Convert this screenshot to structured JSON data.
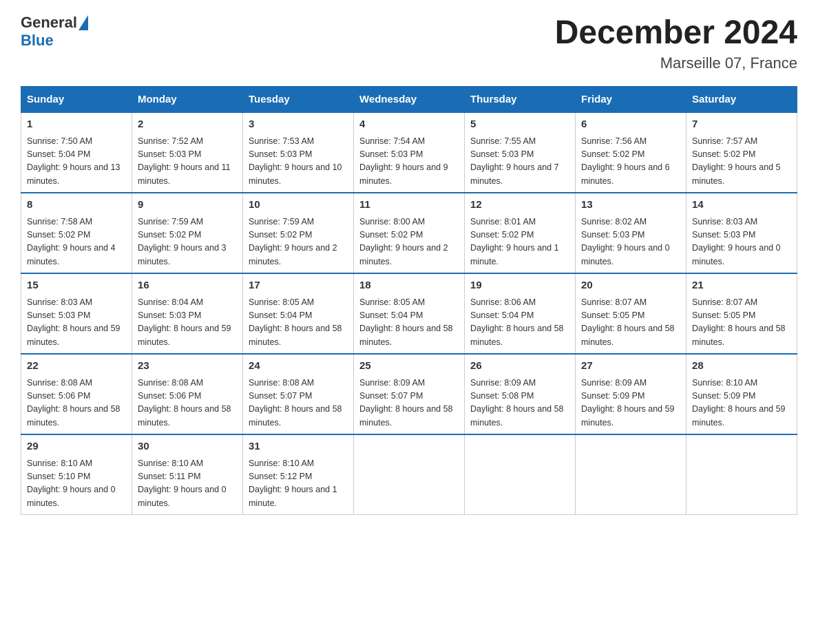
{
  "logo": {
    "general": "General",
    "blue": "Blue"
  },
  "header": {
    "month": "December 2024",
    "location": "Marseille 07, France"
  },
  "days_of_week": [
    "Sunday",
    "Monday",
    "Tuesday",
    "Wednesday",
    "Thursday",
    "Friday",
    "Saturday"
  ],
  "weeks": [
    [
      {
        "day": "1",
        "sunrise": "7:50 AM",
        "sunset": "5:04 PM",
        "daylight": "9 hours and 13 minutes."
      },
      {
        "day": "2",
        "sunrise": "7:52 AM",
        "sunset": "5:03 PM",
        "daylight": "9 hours and 11 minutes."
      },
      {
        "day": "3",
        "sunrise": "7:53 AM",
        "sunset": "5:03 PM",
        "daylight": "9 hours and 10 minutes."
      },
      {
        "day": "4",
        "sunrise": "7:54 AM",
        "sunset": "5:03 PM",
        "daylight": "9 hours and 9 minutes."
      },
      {
        "day": "5",
        "sunrise": "7:55 AM",
        "sunset": "5:03 PM",
        "daylight": "9 hours and 7 minutes."
      },
      {
        "day": "6",
        "sunrise": "7:56 AM",
        "sunset": "5:02 PM",
        "daylight": "9 hours and 6 minutes."
      },
      {
        "day": "7",
        "sunrise": "7:57 AM",
        "sunset": "5:02 PM",
        "daylight": "9 hours and 5 minutes."
      }
    ],
    [
      {
        "day": "8",
        "sunrise": "7:58 AM",
        "sunset": "5:02 PM",
        "daylight": "9 hours and 4 minutes."
      },
      {
        "day": "9",
        "sunrise": "7:59 AM",
        "sunset": "5:02 PM",
        "daylight": "9 hours and 3 minutes."
      },
      {
        "day": "10",
        "sunrise": "7:59 AM",
        "sunset": "5:02 PM",
        "daylight": "9 hours and 2 minutes."
      },
      {
        "day": "11",
        "sunrise": "8:00 AM",
        "sunset": "5:02 PM",
        "daylight": "9 hours and 2 minutes."
      },
      {
        "day": "12",
        "sunrise": "8:01 AM",
        "sunset": "5:02 PM",
        "daylight": "9 hours and 1 minute."
      },
      {
        "day": "13",
        "sunrise": "8:02 AM",
        "sunset": "5:03 PM",
        "daylight": "9 hours and 0 minutes."
      },
      {
        "day": "14",
        "sunrise": "8:03 AM",
        "sunset": "5:03 PM",
        "daylight": "9 hours and 0 minutes."
      }
    ],
    [
      {
        "day": "15",
        "sunrise": "8:03 AM",
        "sunset": "5:03 PM",
        "daylight": "8 hours and 59 minutes."
      },
      {
        "day": "16",
        "sunrise": "8:04 AM",
        "sunset": "5:03 PM",
        "daylight": "8 hours and 59 minutes."
      },
      {
        "day": "17",
        "sunrise": "8:05 AM",
        "sunset": "5:04 PM",
        "daylight": "8 hours and 58 minutes."
      },
      {
        "day": "18",
        "sunrise": "8:05 AM",
        "sunset": "5:04 PM",
        "daylight": "8 hours and 58 minutes."
      },
      {
        "day": "19",
        "sunrise": "8:06 AM",
        "sunset": "5:04 PM",
        "daylight": "8 hours and 58 minutes."
      },
      {
        "day": "20",
        "sunrise": "8:07 AM",
        "sunset": "5:05 PM",
        "daylight": "8 hours and 58 minutes."
      },
      {
        "day": "21",
        "sunrise": "8:07 AM",
        "sunset": "5:05 PM",
        "daylight": "8 hours and 58 minutes."
      }
    ],
    [
      {
        "day": "22",
        "sunrise": "8:08 AM",
        "sunset": "5:06 PM",
        "daylight": "8 hours and 58 minutes."
      },
      {
        "day": "23",
        "sunrise": "8:08 AM",
        "sunset": "5:06 PM",
        "daylight": "8 hours and 58 minutes."
      },
      {
        "day": "24",
        "sunrise": "8:08 AM",
        "sunset": "5:07 PM",
        "daylight": "8 hours and 58 minutes."
      },
      {
        "day": "25",
        "sunrise": "8:09 AM",
        "sunset": "5:07 PM",
        "daylight": "8 hours and 58 minutes."
      },
      {
        "day": "26",
        "sunrise": "8:09 AM",
        "sunset": "5:08 PM",
        "daylight": "8 hours and 58 minutes."
      },
      {
        "day": "27",
        "sunrise": "8:09 AM",
        "sunset": "5:09 PM",
        "daylight": "8 hours and 59 minutes."
      },
      {
        "day": "28",
        "sunrise": "8:10 AM",
        "sunset": "5:09 PM",
        "daylight": "8 hours and 59 minutes."
      }
    ],
    [
      {
        "day": "29",
        "sunrise": "8:10 AM",
        "sunset": "5:10 PM",
        "daylight": "9 hours and 0 minutes."
      },
      {
        "day": "30",
        "sunrise": "8:10 AM",
        "sunset": "5:11 PM",
        "daylight": "9 hours and 0 minutes."
      },
      {
        "day": "31",
        "sunrise": "8:10 AM",
        "sunset": "5:12 PM",
        "daylight": "9 hours and 1 minute."
      },
      null,
      null,
      null,
      null
    ]
  ]
}
